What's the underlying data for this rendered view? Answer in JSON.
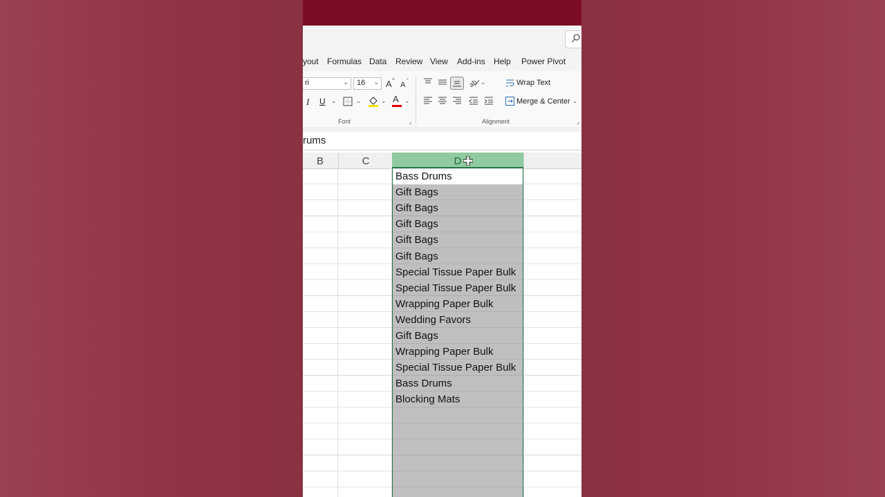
{
  "menu": {
    "items": [
      "yout",
      "Formulas",
      "Data",
      "Review",
      "View",
      "Add-ins",
      "Help",
      "Power Pivot"
    ]
  },
  "ribbon": {
    "font_name": "ri",
    "font_size": "16",
    "font_group_label": "Font",
    "alignment_group_label": "Alignment",
    "wrap_text_label": "Wrap Text",
    "merge_center_label": "Merge & Center",
    "italic_label": "I",
    "underline_label": "U",
    "font_color_label": "A",
    "accent_colors": {
      "highlight": "#f5e100",
      "font_color": "#e00000",
      "excel_green": "#217346"
    }
  },
  "formula_bar": {
    "value": "rums"
  },
  "columns": {
    "b": "B",
    "c": "C",
    "d": "D"
  },
  "cells": [
    "Bass Drums",
    "Gift Bags",
    "Gift Bags",
    "Gift Bags",
    "Gift Bags",
    "Gift Bags",
    "Special Tissue Paper Bulk",
    "Special Tissue Paper Bulk",
    "Wrapping Paper Bulk",
    "Wedding Favors",
    "Gift Bags",
    "Wrapping Paper Bulk",
    "Special Tissue Paper Bulk",
    "Bass Drums",
    "Blocking Mats"
  ]
}
